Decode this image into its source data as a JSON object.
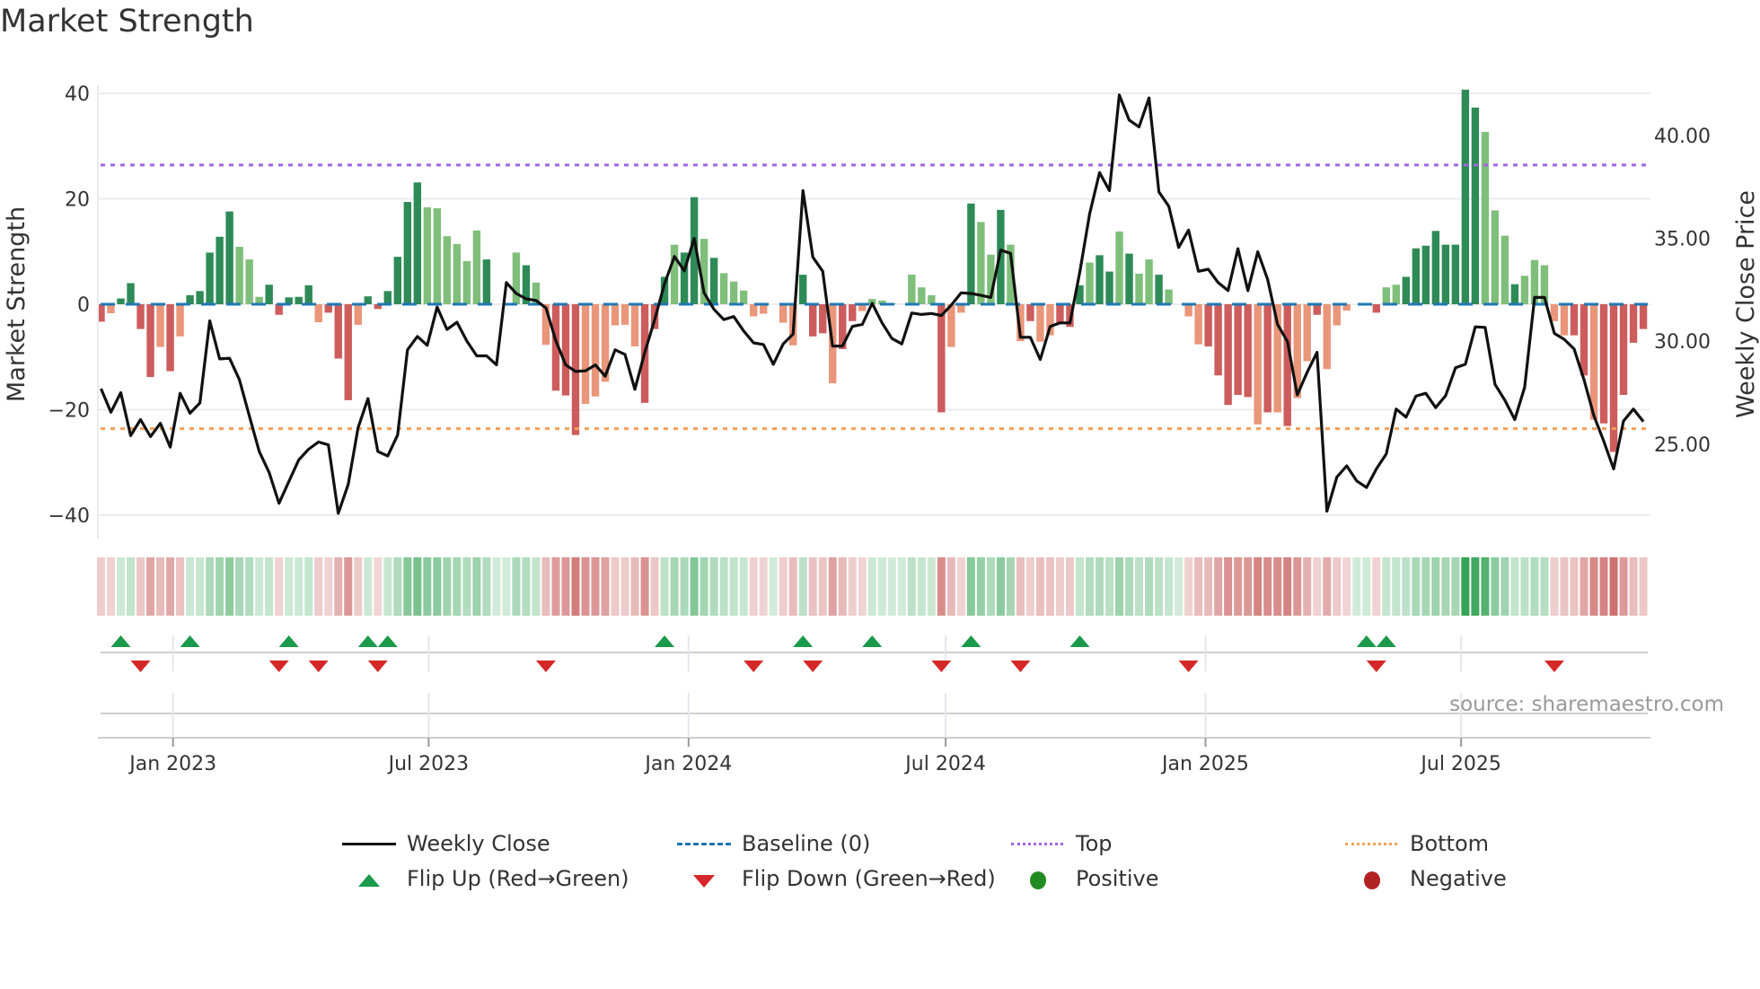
{
  "title": "Market Strength",
  "source": "source: sharemaestro.com",
  "colors": {
    "pos_strong": "#2e8b57",
    "pos_weak": "#7fbf7b",
    "neg_strong": "#cd5c5c",
    "neg_weak": "#e9967a",
    "line": "#111111",
    "baseline": "#1f77b4",
    "top": "#a066e0",
    "bottom": "#f2a05a",
    "flip_up": "#1a9a4a",
    "flip_down": "#d62728",
    "positive": "#228b22",
    "negative": "#b22222"
  },
  "chart_data": {
    "type": "bar+line",
    "title": "Market Strength",
    "ylabel": "Market Strength",
    "y2label": "Weekly Close Price",
    "ylim": [
      -44,
      44
    ],
    "y2lim": [
      21.25,
      42.47
    ],
    "yticks": [
      "40",
      "20",
      "0",
      "−20",
      "−40"
    ],
    "ytick_values": [
      40,
      20,
      0,
      -20,
      -40
    ],
    "y2ticks": [
      "40.00",
      "35.00",
      "30.00",
      "25.00"
    ],
    "y2tick_values": [
      40,
      35,
      30,
      25
    ],
    "x_start_date": "2022-11-11",
    "x_frequency": "weekly",
    "xticks": [
      {
        "label": "Jan 2023",
        "date": "2023-01-01"
      },
      {
        "label": "Jul 2023",
        "date": "2023-07-01"
      },
      {
        "label": "Jan 2024",
        "date": "2024-01-01"
      },
      {
        "label": "Jul 2024",
        "date": "2024-07-01"
      },
      {
        "label": "Jan 2025",
        "date": "2025-01-01"
      },
      {
        "label": "Jul 2025",
        "date": "2025-07-01"
      }
    ],
    "top_level": 26.4,
    "bottom_level": -23.6,
    "strength": [
      -3.3,
      -1.7,
      1.1,
      4,
      -4.7,
      -13.8,
      -8.1,
      -12.7,
      -6.1,
      1.7,
      2.5,
      9.8,
      12.8,
      17.6,
      10.9,
      8.5,
      1.4,
      3.7,
      -2,
      1.3,
      1.4,
      3.6,
      -3.4,
      -1.6,
      -10.3,
      -18.2,
      -3.9,
      1.5,
      -0.9,
      2.5,
      9,
      19.4,
      23.1,
      18.4,
      18.2,
      12.9,
      11.4,
      8.2,
      14,
      8.5,
      0,
      0,
      9.8,
      7.4,
      4.1,
      -7.7,
      -16.4,
      -17.3,
      -24.8,
      -18.9,
      -17.5,
      -14.7,
      -4,
      -3.9,
      -8,
      -18.7,
      -4.7,
      5.2,
      11.3,
      9.8,
      20.3,
      12.4,
      8.8,
      5.9,
      4.3,
      2.6,
      -2.3,
      -1.8,
      0,
      -3.5,
      -7.8,
      5.6,
      -6.1,
      -5.5,
      -15,
      -8.5,
      -3.2,
      -1.3,
      1,
      0.7,
      0.2,
      0,
      5.6,
      3.2,
      1.7,
      -20.5,
      -8.1,
      -1.6,
      19.1,
      15.6,
      9.4,
      17.9,
      11.3,
      -7,
      -3.2,
      -7.1,
      -5.9,
      -3.5,
      -4.3,
      3.6,
      7.9,
      9.3,
      6.2,
      13.8,
      9.6,
      5.8,
      8.5,
      5.6,
      2.8,
      0,
      -2.3,
      -7.6,
      -8,
      -13.5,
      -19.1,
      -17.2,
      -17.6,
      -22.8,
      -20.5,
      -20.5,
      -23.1,
      -17.8,
      -10.8,
      -2,
      -12.3,
      -4,
      -1.2,
      0,
      0.2,
      -1.6,
      3.2,
      3.7,
      5.2,
      10.6,
      11.1,
      13.9,
      11.3,
      11.3,
      40.7,
      37.3,
      32.7,
      17.8,
      13,
      3.8,
      5.4,
      8.4,
      7.4,
      -3.2,
      -5.9,
      -5.9,
      -13.5,
      -21.9,
      -22.6,
      -28,
      -17.2,
      -7.3,
      -4.7
    ],
    "shade": "dlddddldldddddllldddddldddlddddddlllllldl--dlldddlllllldddlddldllllldl-dddlddlllldll-dlldlldlldlldddlddldlldlll-dddddldldlldllldldl-ddddddddllldlllllddlddddddddlll",
    "weekly_close": [
      27.69,
      26.55,
      27.5,
      25.41,
      26.19,
      25.36,
      26.01,
      24.85,
      27.47,
      26.5,
      27.0,
      30.99,
      29.14,
      29.17,
      28.13,
      26.38,
      24.64,
      23.62,
      22.12,
      23.18,
      24.23,
      24.75,
      25.1,
      24.96,
      21.63,
      23.04,
      25.8,
      27.21,
      24.64,
      24.42,
      25.44,
      29.58,
      30.23,
      29.8,
      31.66,
      30.57,
      30.92,
      30.01,
      29.29,
      29.29,
      28.85,
      32.85,
      32.32,
      32.06,
      31.98,
      31.62,
      30.02,
      28.85,
      28.53,
      28.56,
      28.85,
      28.3,
      29.58,
      29.36,
      27.66,
      29.45,
      31.05,
      32.8,
      34.12,
      33.42,
      35.0,
      32.35,
      31.55,
      31.05,
      31.2,
      30.5,
      29.92,
      29.84,
      28.88,
      29.87,
      30.35,
      37.32,
      34.09,
      33.4,
      29.76,
      29.77,
      30.72,
      30.82,
      31.84,
      30.89,
      30.13,
      29.87,
      31.37,
      31.3,
      31.35,
      31.25,
      31.76,
      32.35,
      32.32,
      32.23,
      32.13,
      34.43,
      34.27,
      30.19,
      30.19,
      29.11,
      30.72,
      30.89,
      30.89,
      33.36,
      36.2,
      38.2,
      37.32,
      41.97,
      40.75,
      40.42,
      41.83,
      37.26,
      36.56,
      34.56,
      35.4,
      33.4,
      33.5,
      32.85,
      32.46,
      34.5,
      32.46,
      34.35,
      33.0,
      30.82,
      29.99,
      27.39,
      28.49,
      29.46,
      21.73,
      23.4,
      23.94,
      23.21,
      22.89,
      23.79,
      24.52,
      26.7,
      26.31,
      27.33,
      27.47,
      26.77,
      27.35,
      28.71,
      28.88,
      30.7,
      30.67,
      27.9,
      27.13,
      26.19,
      27.76,
      32.13,
      32.13,
      30.38,
      30.09,
      29.62,
      28.13,
      26.38,
      25.14,
      23.79,
      26.12,
      26.7,
      26.09
    ],
    "flip_up_weeks": [
      2,
      9,
      19,
      27,
      29,
      57,
      71,
      78,
      88,
      99,
      128,
      130
    ],
    "flip_down_weeks": [
      4,
      18,
      22,
      28,
      45,
      66,
      72,
      85,
      93,
      110,
      129,
      147
    ],
    "legend": [
      {
        "key": "line",
        "label": "Weekly Close"
      },
      {
        "key": "baseline",
        "label": "Baseline (0)"
      },
      {
        "key": "top",
        "label": "Top"
      },
      {
        "key": "bottom",
        "label": "Bottom"
      },
      {
        "key": "flip_up",
        "label": "Flip Up (Red→Green)"
      },
      {
        "key": "flip_down",
        "label": "Flip Down (Green→Red)"
      },
      {
        "key": "positive",
        "label": "Positive"
      },
      {
        "key": "negative",
        "label": "Negative"
      }
    ],
    "legend_position": "bottom"
  }
}
